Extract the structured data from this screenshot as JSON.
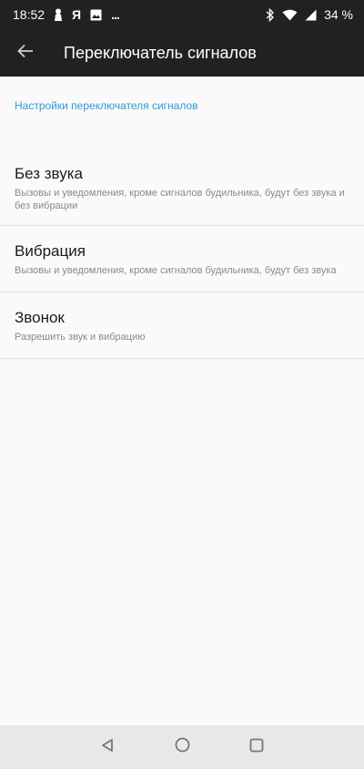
{
  "status_bar": {
    "time": "18:52",
    "carrier_glyph": "Я",
    "more_glyph": "...",
    "battery": "34 %",
    "icons": [
      "person-silhouette-icon",
      "image-icon",
      "bluetooth-icon",
      "wifi-icon",
      "cellular-signal-icon",
      "battery-icon"
    ]
  },
  "app_bar": {
    "title": "Переключатель сигналов",
    "back_icon": "arrow-left-icon"
  },
  "section": {
    "header": "Настройки переключателя сигналов",
    "accent_color": "#2e9ad6"
  },
  "options": [
    {
      "title": "Без звука",
      "summary": "Вызовы и уведомления, кроме сигналов будильника, будут без звука и без вибрации"
    },
    {
      "title": "Вибрация",
      "summary": "Вызовы и уведомления, кроме сигналов будильника, будут без звука"
    },
    {
      "title": "Звонок",
      "summary": "Разрешить звук и вибрацию"
    }
  ],
  "nav_bar": {
    "buttons": [
      "back-triangle-icon",
      "home-circle-icon",
      "recents-square-icon"
    ]
  }
}
